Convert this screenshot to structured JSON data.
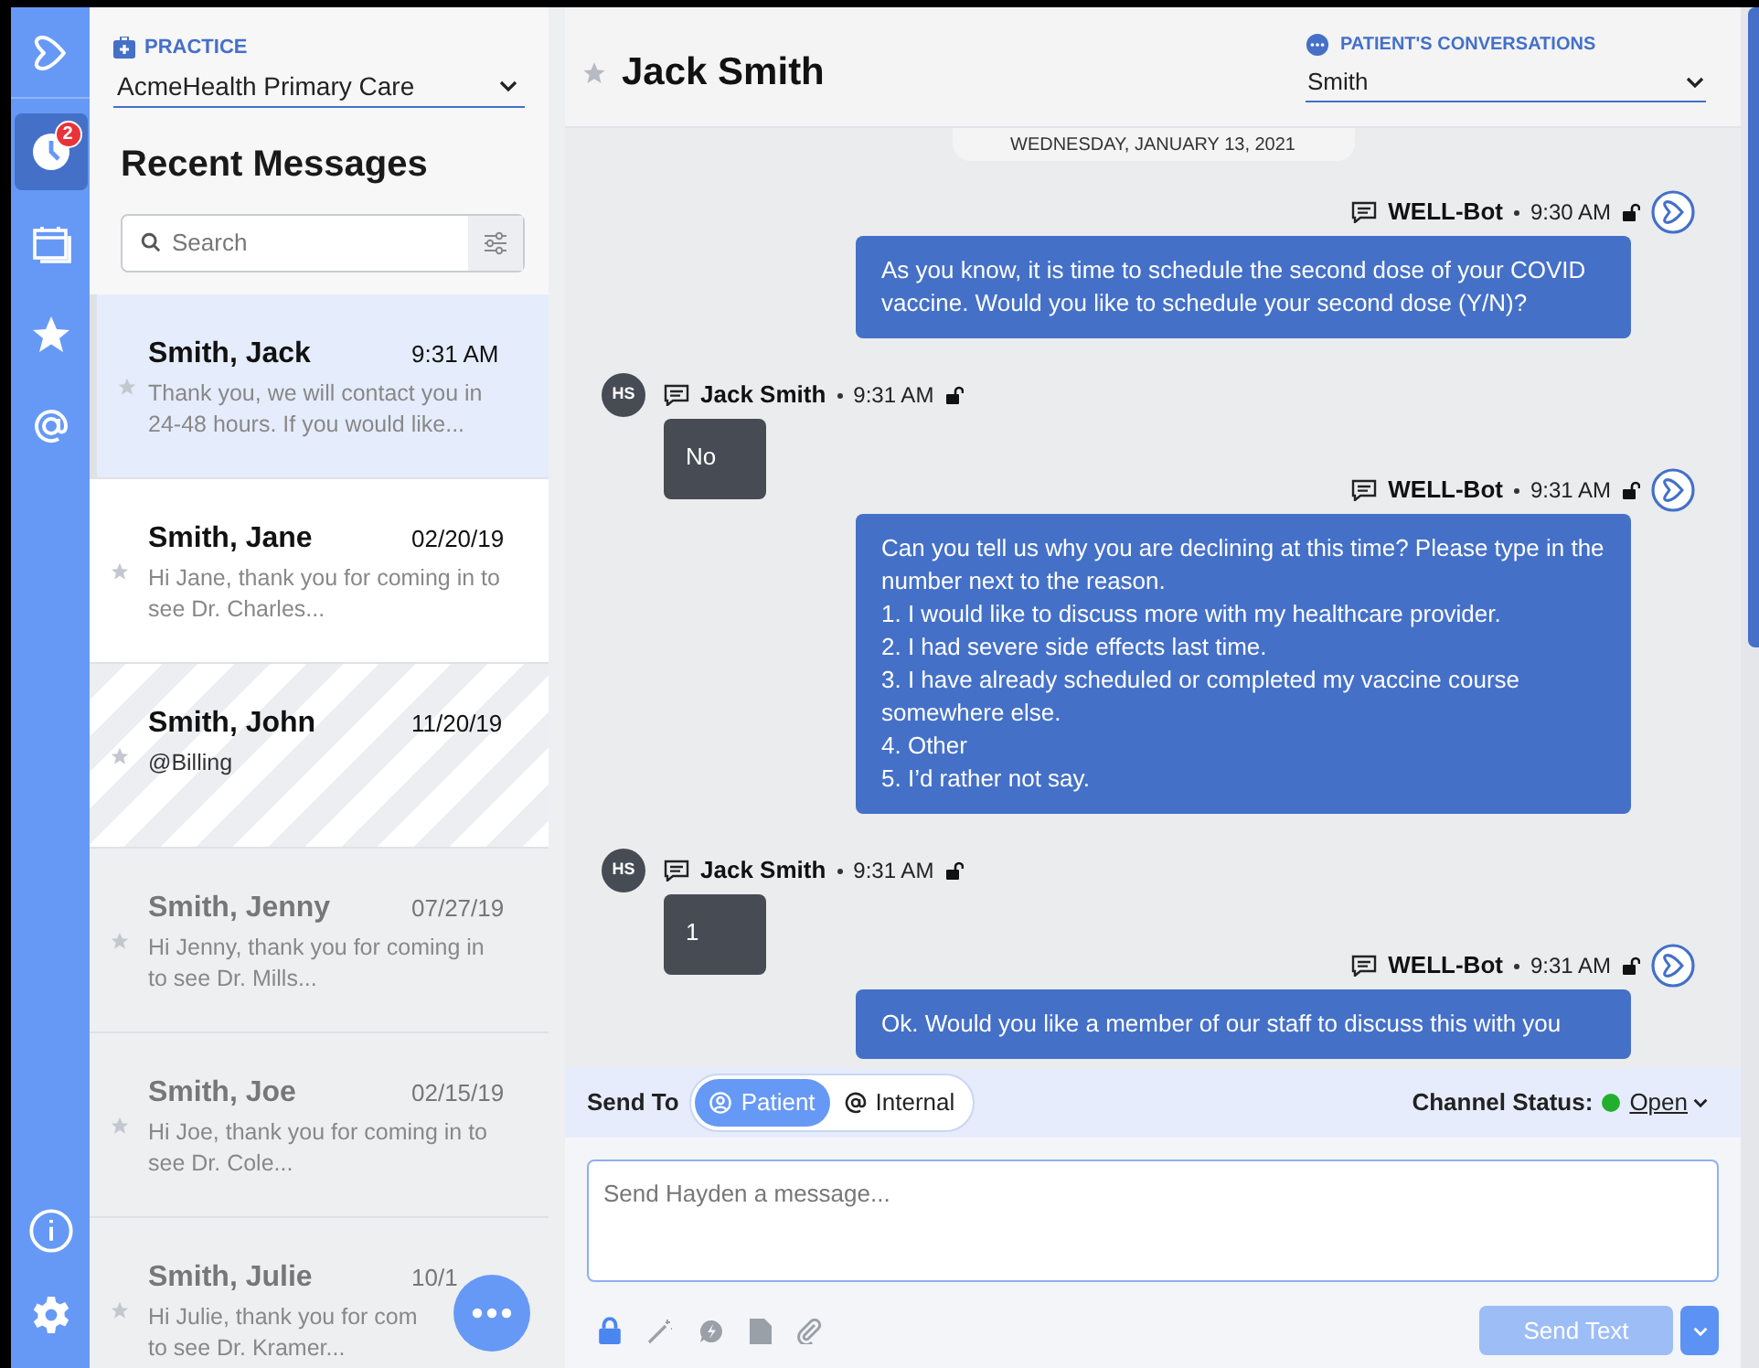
{
  "nav": {
    "items": [
      {
        "kind": "recent",
        "selected": true,
        "badge": "2"
      },
      {
        "kind": "calendar",
        "selected": false
      },
      {
        "kind": "favorites",
        "selected": false
      },
      {
        "kind": "mentions",
        "selected": false
      }
    ],
    "bottom": [
      {
        "kind": "info"
      },
      {
        "kind": "settings"
      }
    ]
  },
  "practice": {
    "label": "PRACTICE",
    "value": "AcmeHealth Primary Care"
  },
  "list_title": "Recent Messages",
  "search": {
    "placeholder": "Search"
  },
  "conversations": [
    {
      "name": "Smith, Jack",
      "time": "9:31 AM",
      "preview": "Thank you, we will contact you in 24-48 hours. If you would like...",
      "kind": "open",
      "selected": true
    },
    {
      "name": "Smith, Jane",
      "time": "02/20/19",
      "preview": "Hi Jane, thank you for coming in to see Dr. Charles...",
      "kind": "open",
      "selected": false
    },
    {
      "name": "Smith, John",
      "time": "11/20/19",
      "preview": "@Billing",
      "kind": "internal",
      "selected": false
    },
    {
      "name": "Smith, Jenny",
      "time": "07/27/19",
      "preview": "Hi Jenny, thank you for coming in to see Dr. Mills...",
      "kind": "closed",
      "selected": false
    },
    {
      "name": "Smith, Joe",
      "time": "02/15/19",
      "preview": "Hi Joe, thank you for coming in to see Dr. Cole...",
      "kind": "closed",
      "selected": false
    },
    {
      "name": "Smith, Julie",
      "time": "10/1",
      "preview": "Hi Julie, thank you for com\nto see Dr. Kramer...",
      "kind": "closed",
      "selected": false
    }
  ],
  "chat": {
    "title": "Jack Smith",
    "conversations_label": "PATIENT'S CONVERSATIONS",
    "conversations_value": "Smith",
    "date": "WEDNESDAY, JANUARY 13, 2021",
    "messages": [
      {
        "kind": "bot",
        "sender": "WELL-Bot",
        "time": "9:30 AM",
        "text": "As you know, it is time to schedule the second dose of your COVID vaccine. Would you like to schedule your second dose (Y/N)?"
      },
      {
        "kind": "patient",
        "sender": "Jack Smith",
        "initials": "HS",
        "time": "9:31 AM",
        "text": "No"
      },
      {
        "kind": "bot",
        "sender": "WELL-Bot",
        "time": "9:31 AM",
        "text": "Can you tell us why you are declining at this time? Please type in the number next to the reason.\n1. I would like to discuss more with my healthcare provider.\n2. I had severe side effects last time.\n3. I have already scheduled or completed my vaccine course somewhere else.\n4. Other\n5. I’d rather not say."
      },
      {
        "kind": "patient",
        "sender": "Jack Smith",
        "initials": "HS",
        "time": "9:31 AM",
        "text": "1"
      },
      {
        "kind": "bot",
        "sender": "WELL-Bot",
        "time": "9:31 AM",
        "text": "Ok. Would you like a member of our staff to discuss this with you"
      }
    ]
  },
  "composer": {
    "send_to_label": "Send To",
    "recipients": [
      {
        "label": "Patient",
        "selected": true
      },
      {
        "label": "Internal",
        "selected": false
      }
    ],
    "channel_status_label": "Channel Status:",
    "channel_status": "Open",
    "placeholder": "Send Hayden a message...",
    "send_button": "Send Text",
    "send_disabled": true
  }
}
